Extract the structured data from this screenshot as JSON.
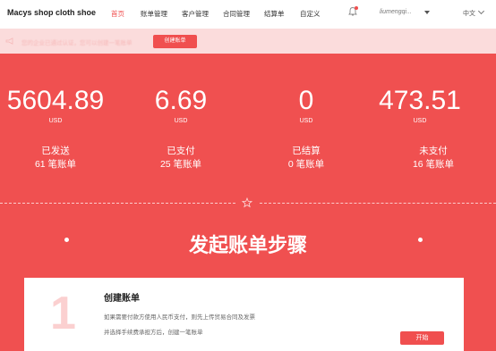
{
  "brand": "Macys shop cloth shoe…",
  "nav": {
    "items": [
      {
        "label": "首页",
        "active": true
      },
      {
        "label": "账单管理",
        "active": false
      },
      {
        "label": "客户管理",
        "active": false
      },
      {
        "label": "合同管理",
        "active": false
      },
      {
        "label": "结算单",
        "active": false
      },
      {
        "label": "自定义",
        "active": false
      }
    ],
    "user": "liumengqi...",
    "lang": "中文"
  },
  "notice": {
    "text": "您的企业已通过认证，您可以创建一笔账单",
    "button": "创建账单"
  },
  "stats": [
    {
      "value": "5604.89",
      "unit": "USD",
      "status": "已发送",
      "count": "61 笔账单"
    },
    {
      "value": "6.69",
      "unit": "USD",
      "status": "已支付",
      "count": "25 笔账单"
    },
    {
      "value": "0",
      "unit": "USD",
      "status": "已结算",
      "count": "0 笔账单"
    },
    {
      "value": "473.51",
      "unit": "USD",
      "status": "未支付",
      "count": "16 笔账单"
    }
  ],
  "steps": {
    "title": "发起账单步骤",
    "card": {
      "number": "1",
      "title": "创建账单",
      "line1": "如果需要付款方使用人民币支付，则先上传贸易合同及发票",
      "line2": "并选择手续费承担方后，创建一笔账单",
      "button": "开始"
    }
  },
  "colors": {
    "accent": "#f04f4f",
    "background": "#f05050",
    "notice_bg": "#fbdcdc"
  }
}
